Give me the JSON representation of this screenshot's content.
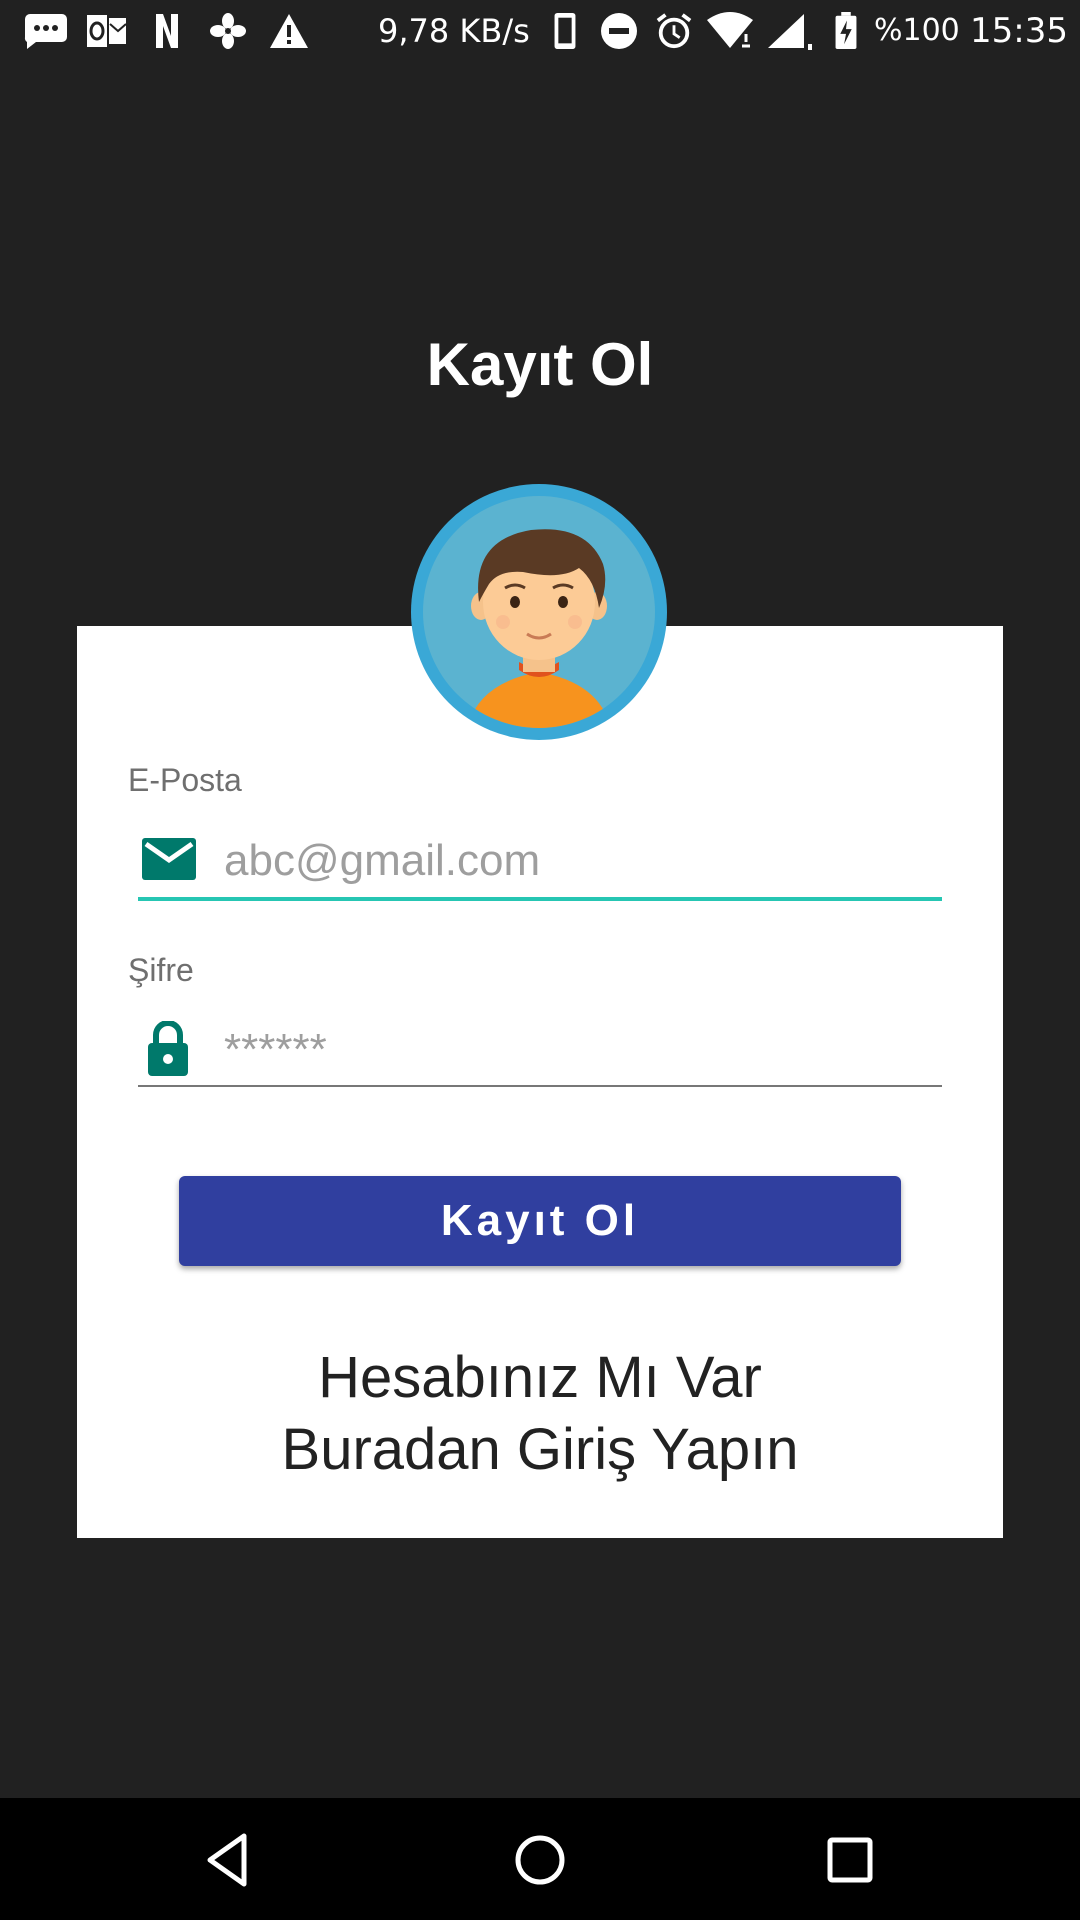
{
  "status_bar": {
    "network_speed": "9,78 KB/s",
    "battery": "%100",
    "time": "15:35",
    "icons": [
      "message-icon",
      "outlook-icon",
      "netflix-icon",
      "pinwheel-icon",
      "warning-icon",
      "phone-icon",
      "do-not-disturb-icon",
      "alarm-icon",
      "wifi-icon",
      "signal-icon",
      "battery-charging-icon"
    ]
  },
  "page": {
    "title": "Kayıt Ol"
  },
  "form": {
    "email": {
      "label": "E-Posta",
      "placeholder": "abc@gmail.com",
      "icon": "mail-icon"
    },
    "password": {
      "label": "Şifre",
      "placeholder": "******",
      "icon": "lock-icon"
    },
    "submit_label": "Kayıt Ol",
    "login_prompt_line1": "Hesabınız Mı Var",
    "login_prompt_line2": "Buradan Giriş Yapın"
  },
  "colors": {
    "background": "#212121",
    "card": "#ffffff",
    "accent": "#26c6b3",
    "icon_teal": "#00796b",
    "button": "#303f9f",
    "avatar_ring": "#3aa8d6"
  },
  "nav_bar": {
    "icons": [
      "back-icon",
      "home-icon",
      "recents-icon"
    ]
  }
}
